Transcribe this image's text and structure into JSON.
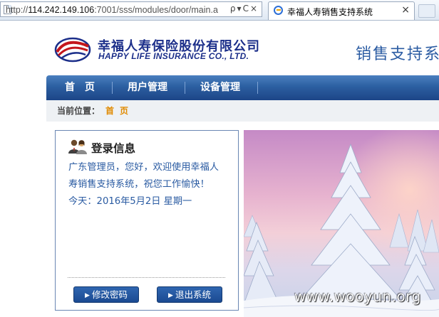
{
  "browser": {
    "url_prefix": "http://",
    "url_host": "114.242.149.106",
    "url_rest": ":7001/sss/modules/door/main.a",
    "tab_title": "幸福人寿销售支持系统",
    "tab_close": "×",
    "address_controls": "ρ▾C×"
  },
  "header": {
    "company_cn": "幸福人寿保险股份有限公司",
    "company_en": "HAPPY LIFE INSURANCE CO., LTD.",
    "system_title": "销售支持系"
  },
  "nav": {
    "items": [
      "首　页",
      "用户管理",
      "设备管理"
    ]
  },
  "breadcrumb": {
    "label": "当前位置：",
    "current": "首页"
  },
  "login_panel": {
    "title": "登录信息",
    "welcome_line1": "广东管理员，您好，欢迎使用幸福人",
    "welcome_line2": "寿销售支持系统，祝您工作愉快！",
    "date_line": "今天：2016年5月2日 星期一",
    "btn_change_password": "修改密码",
    "btn_logout": "退出系统",
    "btn_arrow": "▶"
  },
  "watermark": "www.wooyun.org",
  "colors": {
    "nav_blue": "#2c5fa1",
    "brand_navy": "#1c2f8a",
    "text_blue": "#2a5ba2",
    "crumb_orange": "#e08a00"
  }
}
